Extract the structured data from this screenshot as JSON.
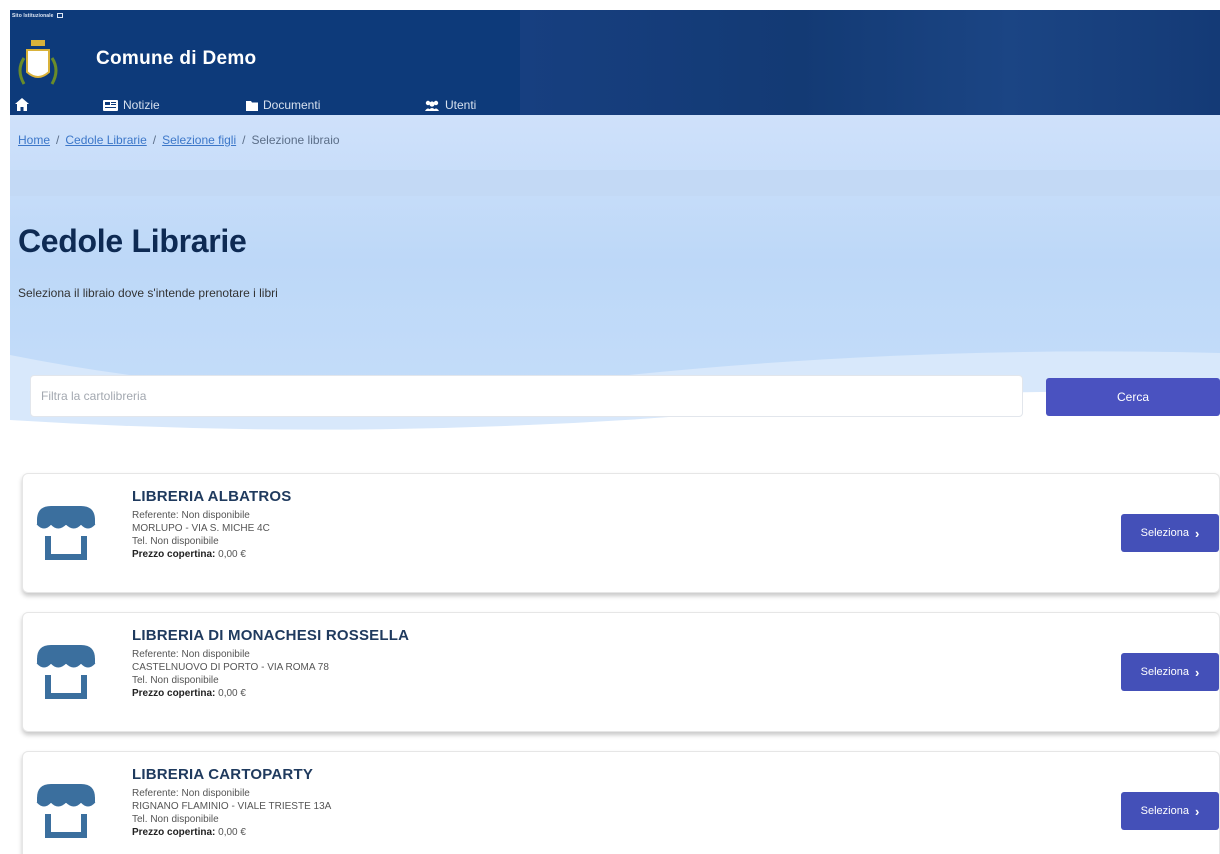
{
  "header": {
    "slim_label": "Sito Istituzionale",
    "brand": "Comune di Demo",
    "nav": [
      {
        "label": "Notizie",
        "icon": "newspaper-icon"
      },
      {
        "label": "Documenti",
        "icon": "folder-icon"
      },
      {
        "label": "Utenti",
        "icon": "users-icon"
      }
    ]
  },
  "breadcrumb": {
    "items": [
      "Home",
      "Cedole Librarie",
      "Selezione figli"
    ],
    "current": "Selezione libraio",
    "separator": "/"
  },
  "page": {
    "title": "Cedole Librarie",
    "subtitle": "Seleziona il libraio dove s'intende prenotare i libri"
  },
  "search": {
    "placeholder": "Filtra la cartolibreria",
    "value": "",
    "button_label": "Cerca"
  },
  "shops": [
    {
      "name": "LIBRERIA ALBATROS",
      "referente": "Referente: Non disponibile",
      "address": "MORLUPO  -  VIA S. MICHE 4C",
      "phone": "Tel.  Non disponibile",
      "price_label": "Prezzo copertina:",
      "price_value": "0,00 €",
      "button_label": "Seleziona"
    },
    {
      "name": "LIBRERIA DI MONACHESI ROSSELLA",
      "referente": "Referente: Non disponibile",
      "address": "CASTELNUOVO DI PORTO  -  VIA ROMA 78",
      "phone": "Tel.  Non disponibile",
      "price_label": "Prezzo copertina:",
      "price_value": "0,00 €",
      "button_label": "Seleziona"
    },
    {
      "name": "LIBRERIA CARTOPARTY",
      "referente": "Referente: Non disponibile",
      "address": "RIGNANO FLAMINIO  -  VIALE TRIESTE 13A",
      "phone": "Tel.  Non disponibile",
      "price_label": "Prezzo copertina:",
      "price_value": "0,00 €",
      "button_label": "Seleziona"
    }
  ],
  "colors": {
    "header": "#0d3a7a",
    "accent": "#4a52c0",
    "title": "#0e2a53",
    "hero": "#c6defa"
  }
}
